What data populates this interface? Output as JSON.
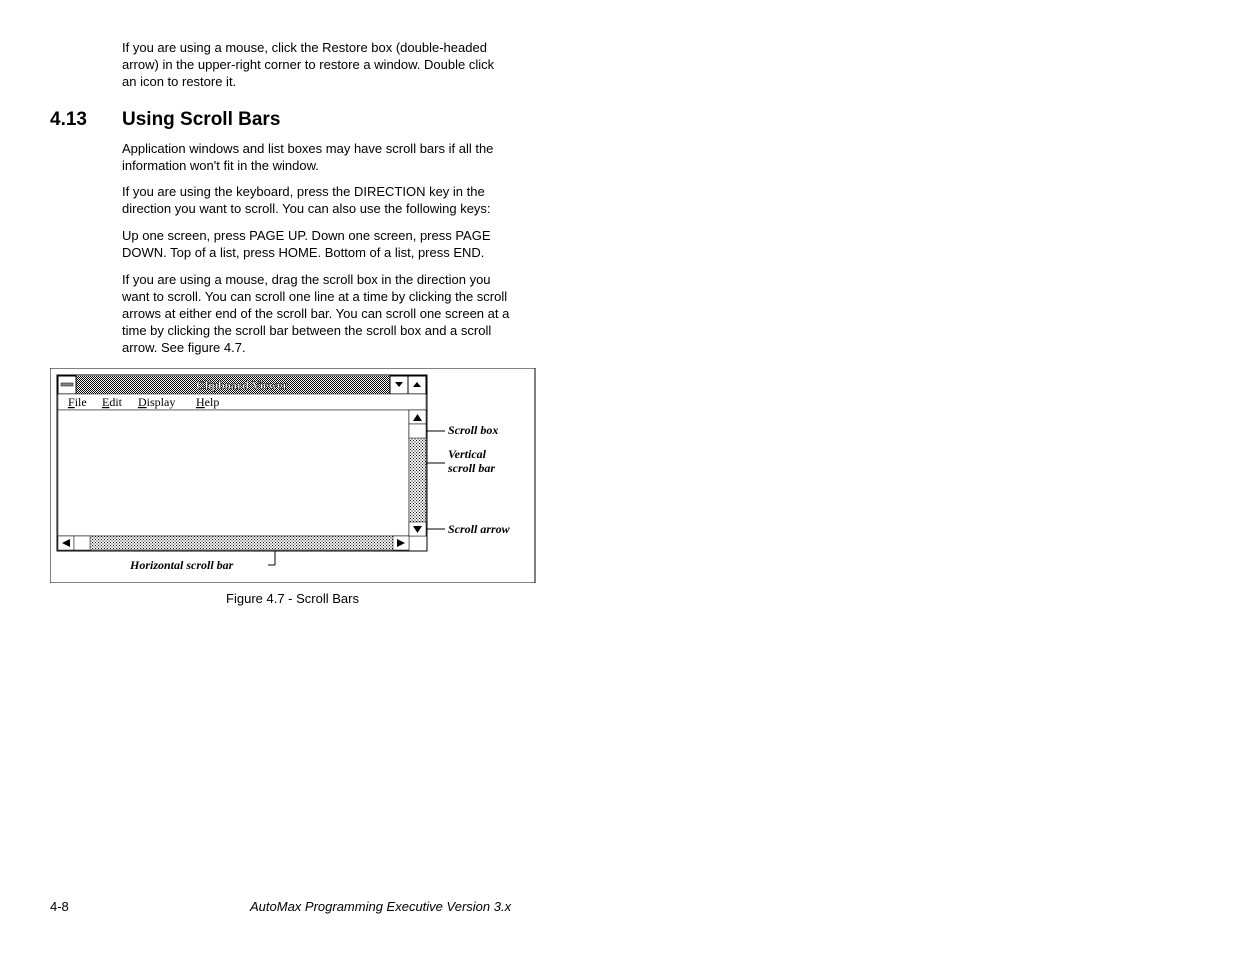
{
  "intro": "If you are using a mouse, click the Restore box (double-headed arrow) in the upper-right corner to restore a window. Double click an icon to restore it.",
  "section": {
    "number": "4.13",
    "title": "Using Scroll Bars"
  },
  "p1": "Application windows and list boxes may have scroll bars if all the information won't fit in the window.",
  "p2": "If you are using the keyboard, press the DIRECTION key in the direction you want to scroll. You can also use the following keys:",
  "p3": "Up one screen, press PAGE UP. Down one screen, press PAGE DOWN. Top of a list, press HOME. Bottom of a list, press END.",
  "p4": "If you are using a mouse, drag the scroll box in the direction you want to scroll. You can scroll one line at a time by clicking the scroll arrows at either end of the scroll bar. You can scroll one screen at a time by clicking the scroll bar between the scroll box and a scroll arrow. See figure 4.7.",
  "figure": {
    "window_title": "Clipboard Viewer",
    "menu": {
      "file": "File",
      "edit": "Edit",
      "display": "Display",
      "help": "Help"
    },
    "callouts": {
      "scroll_box": "Scroll box",
      "vertical_bar": "Vertical scroll bar",
      "scroll_arrow": "Scroll arrow",
      "horizontal_bar": "Horizontal scroll bar"
    },
    "caption": "Figure 4.7 - Scroll Bars"
  },
  "footer": {
    "page": "4-8",
    "title": "AutoMax Programming Executive Version 3.x"
  }
}
